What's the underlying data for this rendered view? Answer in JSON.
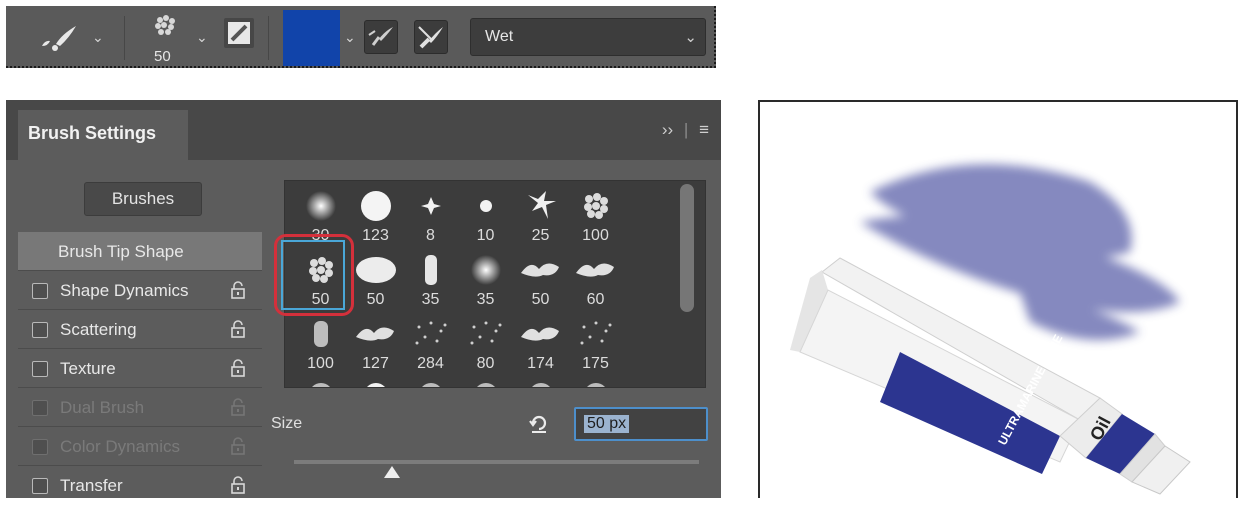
{
  "options_bar": {
    "brush_size_label": "50",
    "foreground_color": "#1144aa",
    "mode_value": "Wet",
    "icons": [
      "mixer-brush-icon",
      "brush-preset-icon",
      "brush-settings-panel-icon",
      "load-brush-icon",
      "clean-brush-icon"
    ]
  },
  "panel": {
    "tab_title": "Brush Settings",
    "brushes_button": "Brushes",
    "options": [
      {
        "label": "Brush Tip Shape",
        "selected": true,
        "enabled": true
      },
      {
        "label": "Shape Dynamics",
        "selected": false,
        "enabled": true
      },
      {
        "label": "Scattering",
        "selected": false,
        "enabled": true
      },
      {
        "label": "Texture",
        "selected": false,
        "enabled": true
      },
      {
        "label": "Dual Brush",
        "selected": false,
        "enabled": false
      },
      {
        "label": "Color Dynamics",
        "selected": false,
        "enabled": false
      },
      {
        "label": "Transfer",
        "selected": false,
        "enabled": true
      }
    ],
    "brush_tips": [
      "30",
      "123",
      "8",
      "10",
      "25",
      "100",
      "50",
      "50",
      "35",
      "35",
      "50",
      "60",
      "100",
      "127",
      "284",
      "80",
      "174",
      "175"
    ],
    "selected_tip_index": 6,
    "size_label": "Size",
    "size_value": "50 px"
  },
  "illustration": {
    "tube_text": "ULTRAMARINE BLUE",
    "tube_cap_text": "Oil",
    "paint_color": "#6f75b4",
    "tube_band_color": "#2c3590"
  }
}
